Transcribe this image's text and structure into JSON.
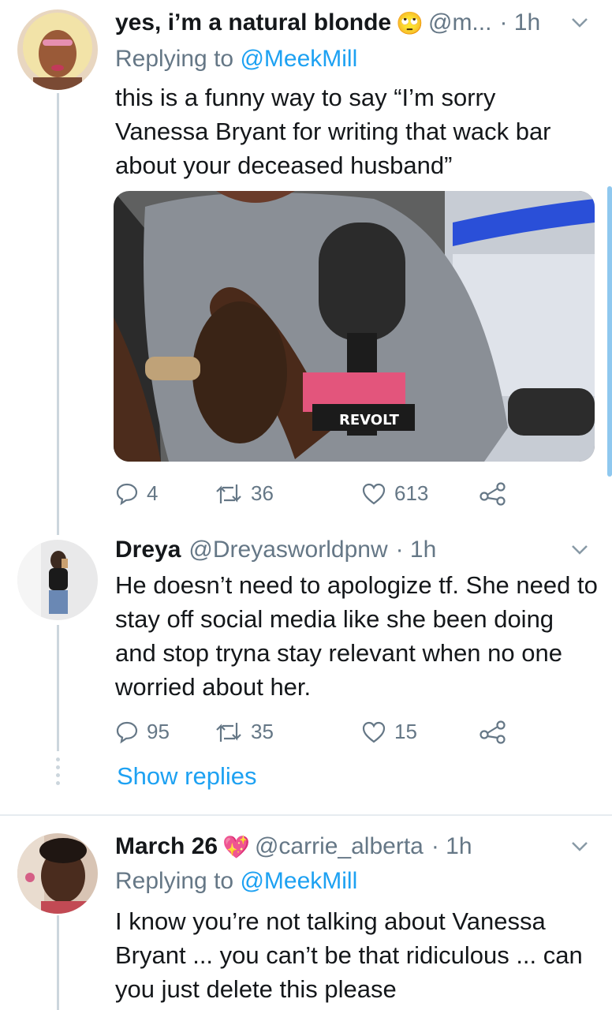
{
  "tweets": [
    {
      "name": "yes, i’m a natural blonde",
      "emoji": "🙄",
      "handle": "@m...",
      "time": "· 1h",
      "replying_prefix": "Replying to ",
      "replying_handle": "@MeekMill",
      "text": "this is a funny way to say “I’m sorry Vanessa Bryant for writing that wack bar about your deceased husband”",
      "media_label": "REVOLT",
      "counts": {
        "replies": "4",
        "retweets": "36",
        "likes": "613"
      }
    },
    {
      "name": "Dreya",
      "handle": "@Dreyasworldpnw",
      "time": "· 1h",
      "text": "He doesn’t need to apologize tf. She need to stay off social media like she been doing and stop tryna stay relevant when no one worried about her.",
      "counts": {
        "replies": "95",
        "retweets": "35",
        "likes": "15"
      },
      "show_replies": "Show replies"
    },
    {
      "name": "March 26",
      "emoji": "💖",
      "handle": "@carrie_alberta",
      "time": "· 1h",
      "replying_prefix": "Replying to ",
      "replying_handle": "@MeekMill",
      "text": "I know you’re not talking about Vanessa Bryant ... you can’t be that ridiculous ... can you just delete this please"
    }
  ],
  "colors": {
    "link": "#1da1f2",
    "muted": "#657786",
    "thread_line": "#ccd6dd"
  },
  "icons": [
    "reply-icon",
    "retweet-icon",
    "like-icon",
    "share-icon",
    "chevron-down-icon"
  ]
}
